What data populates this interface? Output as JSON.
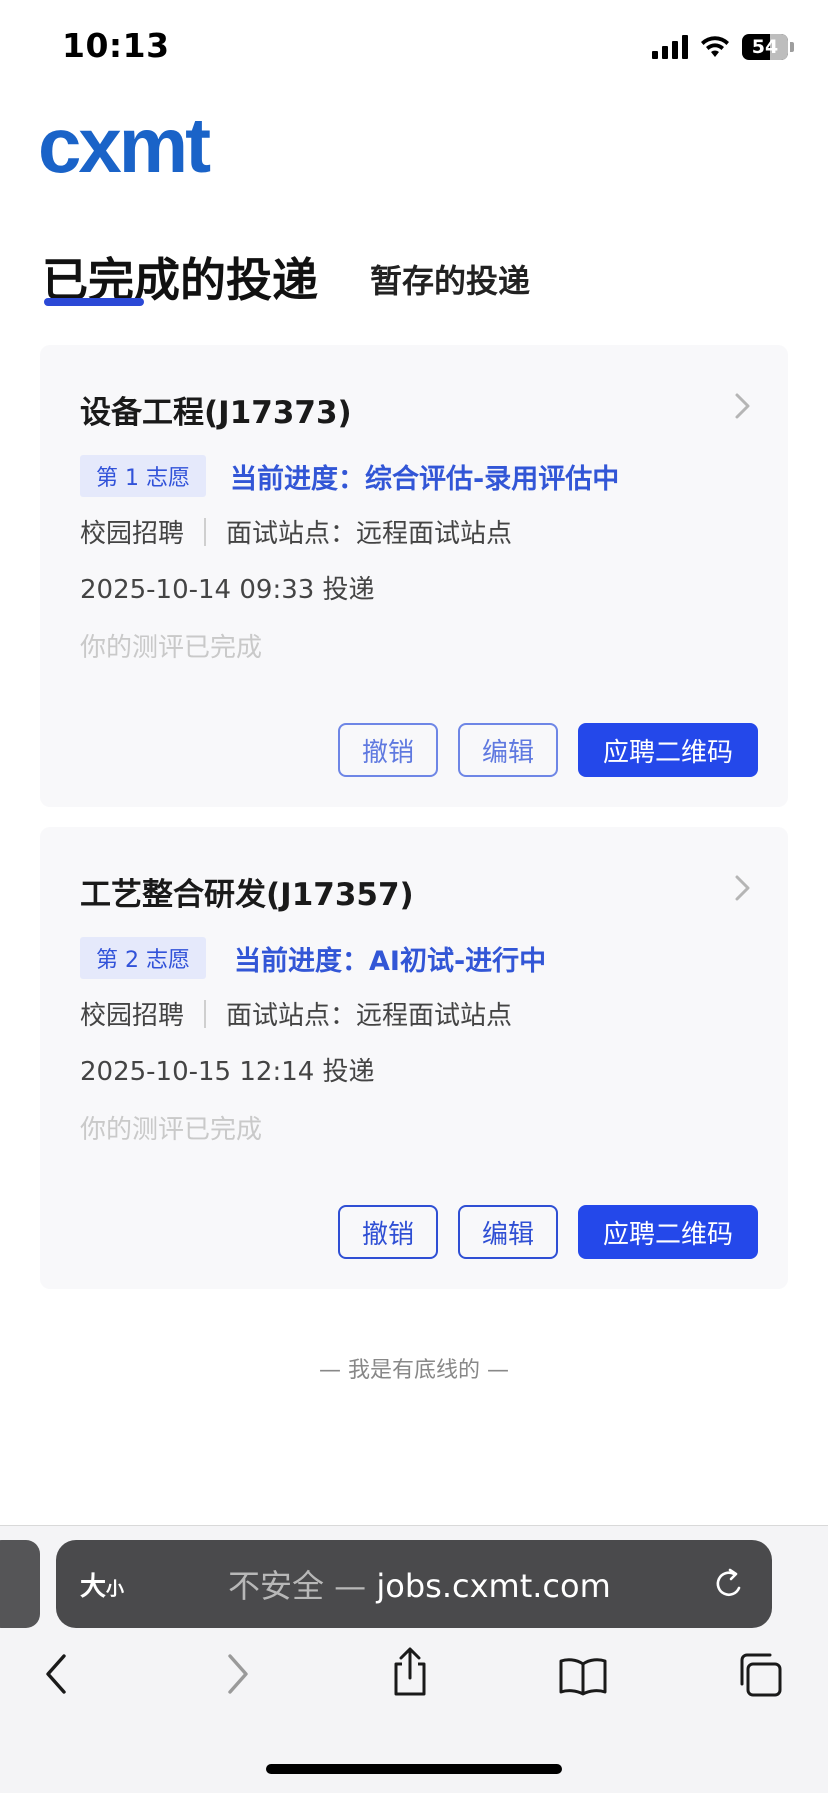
{
  "status_bar": {
    "time": "10:13",
    "battery": "54"
  },
  "logo": {
    "text": "cxmt",
    "color": "#1a63c8"
  },
  "tabs": {
    "active": "已完成的投递",
    "inactive": "暂存的投递"
  },
  "applications": [
    {
      "title": "设备工程(J17373)",
      "choice": "第 1 志愿",
      "progress": "当前进度：综合评估-录用评估中",
      "channel": "校园招聘",
      "site": "面试站点：远程面试站点",
      "date": "2025-10-14 09:33 投递",
      "evaluation": "你的测评已完成",
      "actions": {
        "withdraw": "撤销",
        "edit": "编辑",
        "qrcode": "应聘二维码"
      }
    },
    {
      "title": "工艺整合研发(J17357)",
      "choice": "第 2 志愿",
      "progress": "当前进度：AI初试-进行中",
      "channel": "校园招聘",
      "site": "面试站点：远程面试站点",
      "date": "2025-10-15 12:14 投递",
      "evaluation": "你的测评已完成",
      "actions": {
        "withdraw": "撤销",
        "edit": "编辑",
        "qrcode": "应聘二维码"
      }
    }
  ],
  "footer": {
    "bottom_line": "— 我是有底线的 —"
  },
  "browser": {
    "text_size": "大",
    "text_size_small": "小",
    "insecure": "不安全 —",
    "domain": "jobs.cxmt.com"
  },
  "colors": {
    "accent": "#2448ea",
    "progress": "#3256d6",
    "badge_bg": "#e5e9fb"
  }
}
